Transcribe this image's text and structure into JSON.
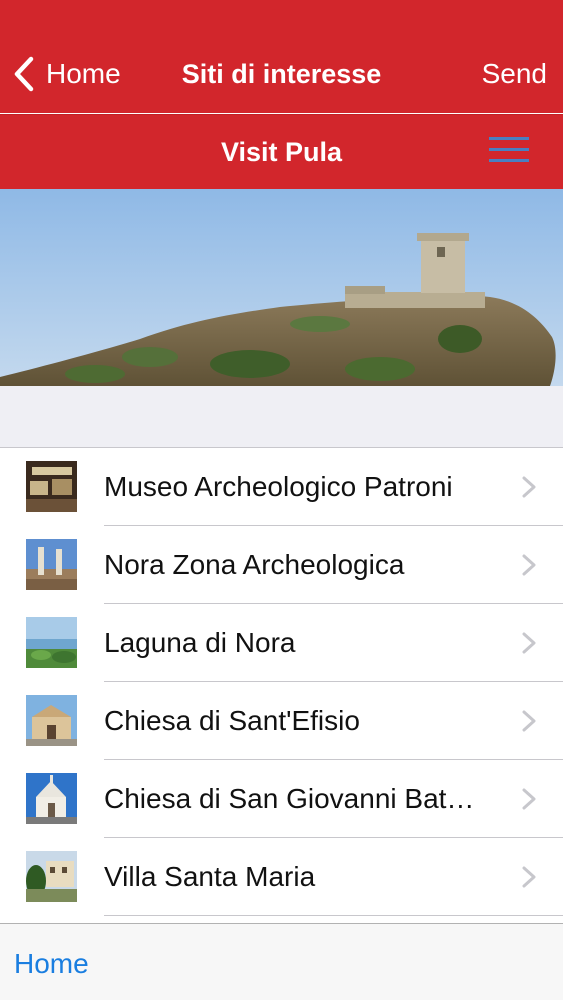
{
  "colors": {
    "brand": "#d2262c",
    "link": "#1a7ee0",
    "menu_icon": "#4a7fc1"
  },
  "navbar": {
    "back_label": "Home",
    "title": "Siti di interesse",
    "action_label": "Send",
    "back_icon": "chevron-left-icon"
  },
  "subbar": {
    "title": "Visit Pula",
    "menu_icon": "hamburger-menu-icon"
  },
  "hero": {
    "description_icon": "hero-image"
  },
  "list": {
    "items": [
      {
        "label": "Museo Archeologico Patroni"
      },
      {
        "label": "Nora Zona Archeologica"
      },
      {
        "label": "Laguna di Nora"
      },
      {
        "label": "Chiesa di Sant'Efisio"
      },
      {
        "label": "Chiesa di San Giovanni Bat…"
      },
      {
        "label": "Villa Santa Maria"
      }
    ]
  },
  "toolbar": {
    "home_label": "Home"
  }
}
